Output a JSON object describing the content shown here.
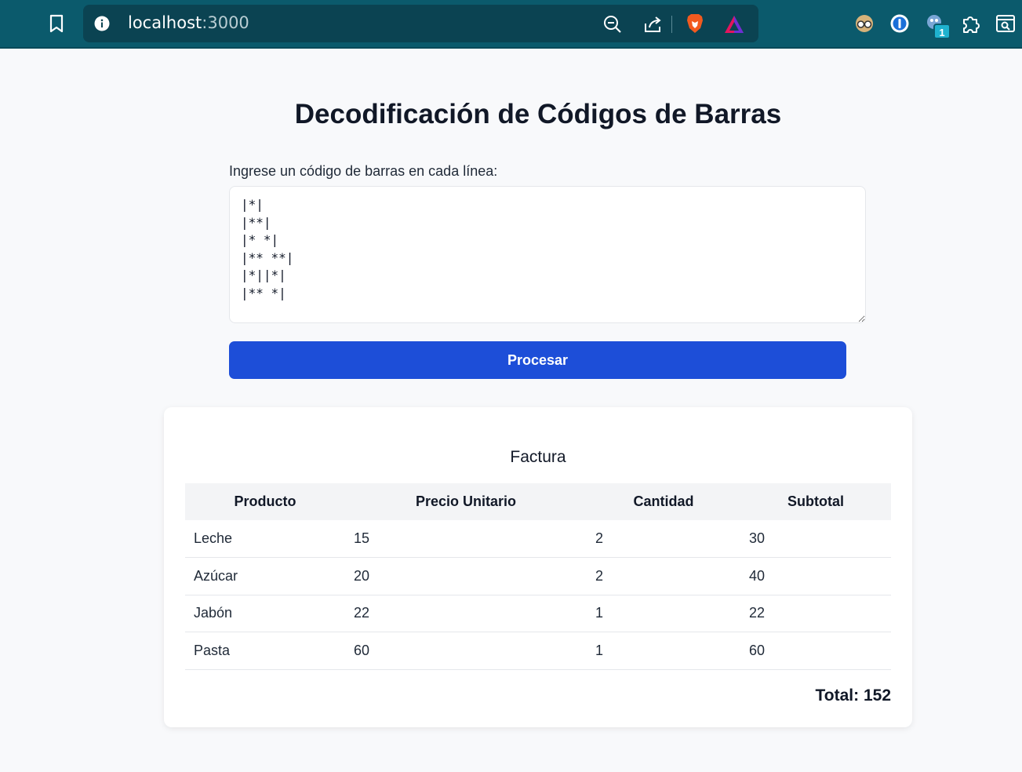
{
  "browser": {
    "url_host": "localhost",
    "url_port": ":3000",
    "extension_badge": "1"
  },
  "page": {
    "title": "Decodificación de Códigos de Barras",
    "input_label": "Ingrese un código de barras en cada línea:",
    "codes_value": "|*|\n|**|\n|* *|\n|** **|\n|*||*|\n|** *|",
    "process_button": "Procesar"
  },
  "invoice": {
    "title": "Factura",
    "columns": [
      "Producto",
      "Precio Unitario",
      "Cantidad",
      "Subtotal"
    ],
    "rows": [
      [
        "Leche",
        "15",
        "2",
        "30"
      ],
      [
        "Azúcar",
        "20",
        "2",
        "40"
      ],
      [
        "Jabón",
        "22",
        "1",
        "22"
      ],
      [
        "Pasta",
        "60",
        "1",
        "60"
      ]
    ],
    "total": "Total: 152"
  },
  "colors": {
    "chrome": "#0b5a6c",
    "primary_button": "#1d4ed8",
    "table_header": "#f3f4f6"
  },
  "icons": [
    "bookmark-icon",
    "info-icon",
    "zoom-out-icon",
    "share-icon",
    "brave-shield-icon",
    "brave-rewards-icon",
    "extension-glasses-icon",
    "onepassword-icon",
    "extension-badge-icon",
    "puzzle-icon",
    "reader-icon"
  ]
}
